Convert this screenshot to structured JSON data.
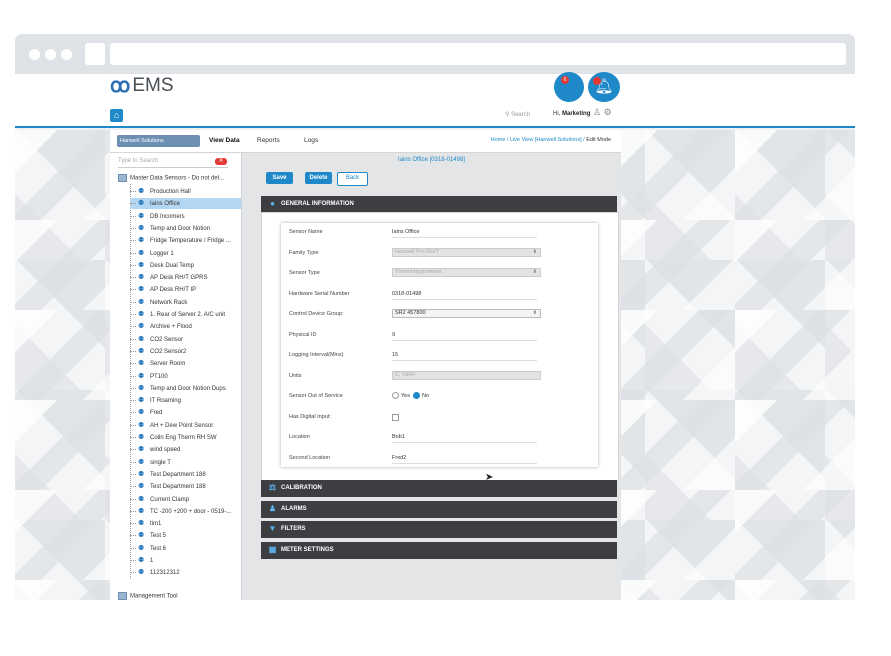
{
  "app": {
    "brand": "EMS"
  },
  "header": {
    "search_placeholder": "Search",
    "greeting": "Hi,",
    "user": "Marketing",
    "chat_badge": "6"
  },
  "nav": {
    "org": "Hanwell Solutions",
    "items": [
      "View Data",
      "Reports",
      "Logs"
    ],
    "breadcrumb": [
      "Home",
      "Live View [Hanwell Solutions]",
      "Edit Mode"
    ]
  },
  "tree": {
    "search_placeholder": "Type to Search",
    "root": "Master Data Sensors - Do not del...",
    "items": [
      "Production Hall",
      "Iains Office",
      "DB Incomers",
      "Temp and Door Notion",
      "Fridge Temperature / Fridge ...",
      "Logger 1",
      "Desk Dual Temp",
      "AP Desk RH/T GPRS",
      "AP Desk RH/T IP",
      "Network Rack",
      "1. Rear of Server 2. A/C unit",
      "Archive + Flood",
      "CO2 Sensor",
      "CO2 Sensor2",
      "Server Room",
      "PT100",
      "Temp and Door Notion Dups",
      "IT Roaming",
      "Fred",
      "AH + Dew Point Sensor",
      "Colin Eng Therm RH SW",
      "wind speed",
      "single T",
      "Test Department 188",
      "Test Department 188",
      "Current Clamp",
      "TC -200 +200 + door - 0519-...",
      "tim1",
      "Test 5",
      "Test 6",
      "1",
      "112312312"
    ],
    "selected_index": 1,
    "footer": "Management Tool"
  },
  "content": {
    "title": "Iains Office [0318-01498]",
    "buttons": {
      "save": "Save",
      "delete": "Delete",
      "back": "Back"
    },
    "sections": [
      "GENERAL INFORMATION",
      "CALIBRATION",
      "ALARMS",
      "FILTERS",
      "METER SETTINGS"
    ],
    "form": {
      "sensor_name": {
        "label": "Sensor Name",
        "value": "Iains Office"
      },
      "family_type": {
        "label": "Family Type",
        "value": "Hanwell Pro RH/T"
      },
      "sensor_type": {
        "label": "Sensor Type",
        "value": "Thermohygrometer"
      },
      "serial": {
        "label": "Hardware Serial Number",
        "value": "0318-01498"
      },
      "device_group": {
        "label": "Control Device Group:",
        "value": "SR2 457800"
      },
      "physical_id": {
        "label": "Physical ID",
        "value": "9"
      },
      "interval": {
        "label": "Logging Interval(Mins)",
        "value": "15"
      },
      "units": {
        "label": "Units",
        "value": "C, %RH"
      },
      "out_of_service": {
        "label": "Sensor Out of Service",
        "yes": "Yes",
        "no": "No"
      },
      "digital_input": {
        "label": "Has Digital Input:"
      },
      "location": {
        "label": "Location",
        "value": "Bob1"
      },
      "second_location": {
        "label": "Second Location",
        "value": "Fred2"
      }
    }
  },
  "colors": {
    "accent": "#1e88c8",
    "section_bar": "#3c3e41",
    "badge": "#e53935"
  }
}
